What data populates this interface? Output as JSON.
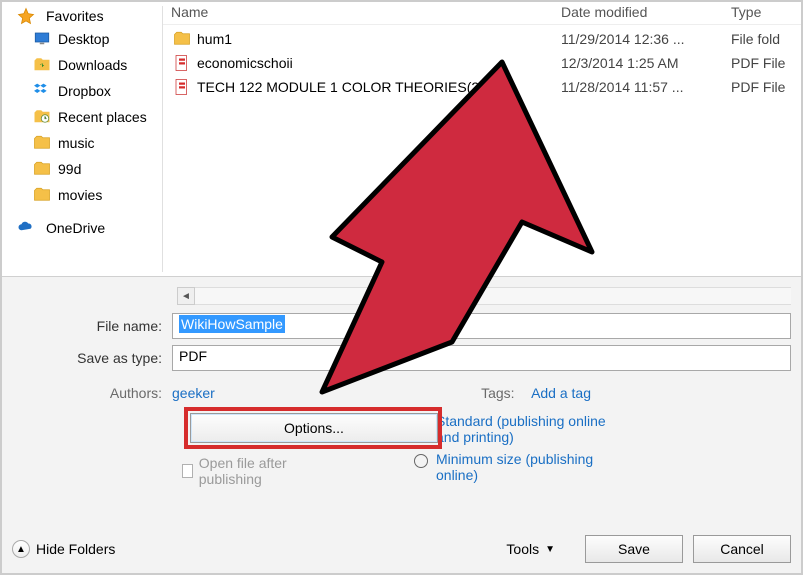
{
  "sidebar": {
    "favorites_label": "Favorites",
    "items": [
      {
        "label": "Desktop",
        "icon": "desktop-icon"
      },
      {
        "label": "Downloads",
        "icon": "downloads-icon"
      },
      {
        "label": "Dropbox",
        "icon": "dropbox-icon"
      },
      {
        "label": "Recent places",
        "icon": "recent-icon"
      },
      {
        "label": "music",
        "icon": "folder-icon"
      },
      {
        "label": "99d",
        "icon": "folder-icon"
      },
      {
        "label": "movies",
        "icon": "folder-icon"
      }
    ],
    "onedrive_label": "OneDrive"
  },
  "columns": {
    "name": "Name",
    "date": "Date modified",
    "type": "Type"
  },
  "files": [
    {
      "name": "hum1",
      "date": "11/29/2014 12:36 ...",
      "type": "File fold",
      "icon": "folder"
    },
    {
      "name": "economicschoii",
      "date": "12/3/2014 1:25 AM",
      "type": "PDF File",
      "icon": "pdf"
    },
    {
      "name": "TECH 122 MODULE 1 COLOR THEORIES(2)",
      "date": "11/28/2014 11:57 ...",
      "type": "PDF File",
      "icon": "pdf"
    }
  ],
  "form": {
    "filename_label": "File name:",
    "filename_value": "WikiHowSample",
    "saveas_label": "Save as type:",
    "saveas_value": "PDF",
    "authors_label": "Authors:",
    "authors_value": "geeker",
    "tags_label": "Tags:",
    "tags_value": "Add a tag",
    "options_label": "Options...",
    "openfile_label": "Open file after publishing",
    "radio_standard": "Standard (publishing online and printing)",
    "radio_minimum": "Minimum size (publishing online)"
  },
  "footer": {
    "hide_folders": "Hide Folders",
    "tools": "Tools",
    "save": "Save",
    "cancel": "Cancel"
  }
}
